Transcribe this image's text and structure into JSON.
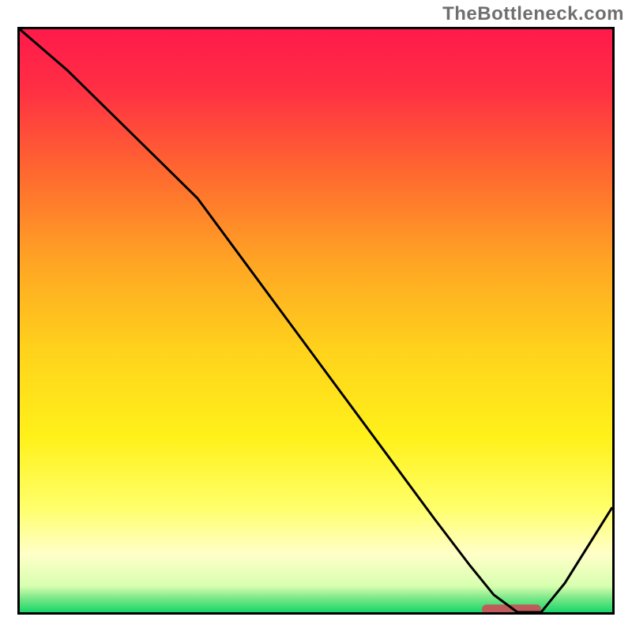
{
  "watermark": "TheBottleneck.com",
  "colors": {
    "border": "#000000",
    "watermark_text": "#6f6f6f",
    "gradient_stops": [
      {
        "offset": 0.0,
        "color": "#ff1a4b"
      },
      {
        "offset": 0.1,
        "color": "#ff2e44"
      },
      {
        "offset": 0.25,
        "color": "#ff6a2f"
      },
      {
        "offset": 0.4,
        "color": "#ffa524"
      },
      {
        "offset": 0.55,
        "color": "#ffd21c"
      },
      {
        "offset": 0.7,
        "color": "#fff11a"
      },
      {
        "offset": 0.82,
        "color": "#ffff6a"
      },
      {
        "offset": 0.9,
        "color": "#ffffc8"
      },
      {
        "offset": 0.955,
        "color": "#d8ffb0"
      },
      {
        "offset": 0.975,
        "color": "#7fe88a"
      },
      {
        "offset": 1.0,
        "color": "#18d66a"
      }
    ],
    "curve": "#000000",
    "marker": "#c15a5a"
  },
  "chart_data": {
    "type": "line",
    "title": "",
    "xlabel": "",
    "ylabel": "",
    "xlim": [
      0,
      100
    ],
    "ylim": [
      0,
      100
    ],
    "x": [
      0,
      8,
      16,
      24,
      30,
      38,
      46,
      54,
      62,
      70,
      76,
      80,
      84,
      88,
      92,
      100
    ],
    "values": [
      100,
      93,
      85,
      77,
      71,
      60,
      49,
      38,
      27,
      16,
      8,
      3,
      0,
      0,
      5,
      18
    ],
    "marker": {
      "x_start": 78,
      "x_end": 88,
      "y": 0.5
    },
    "annotations": []
  }
}
